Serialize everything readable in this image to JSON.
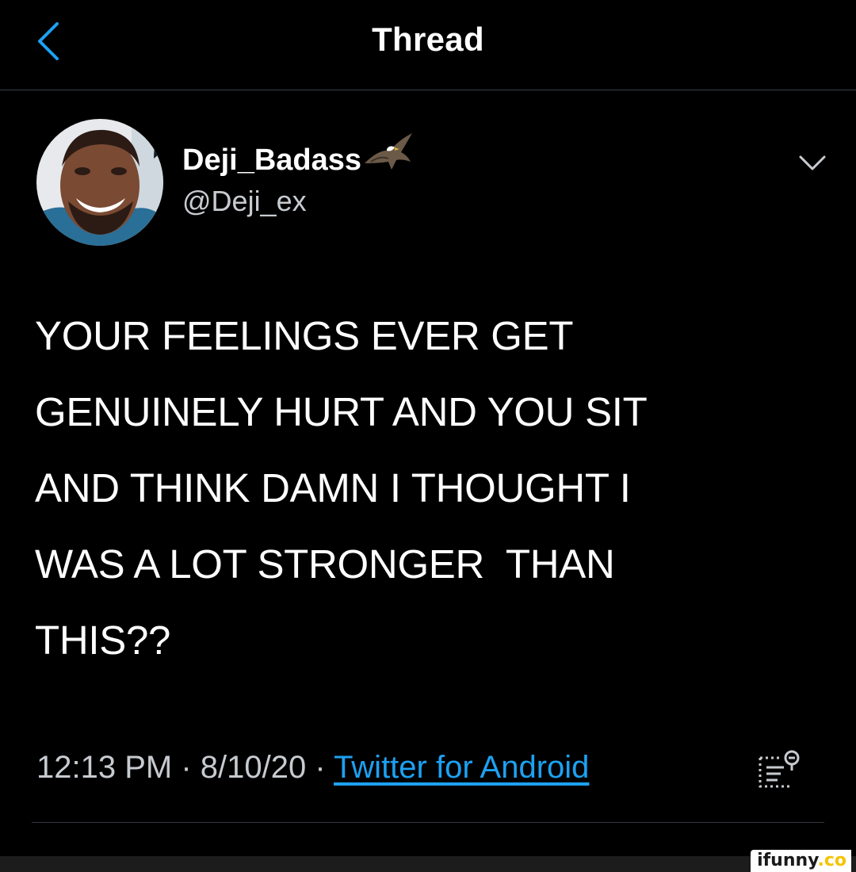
{
  "header": {
    "title": "Thread",
    "back_icon": "chevron-left-icon",
    "accent": "#1da1f2"
  },
  "tweet": {
    "author": {
      "display_name": "Deji_Badass",
      "handle": "@Deji_ex",
      "name_emoji": "eagle-icon"
    },
    "text_lines": [
      "YOUR FEELINGS EVER GET",
      "GENUINELY HURT AND YOU SIT",
      "AND THINK DAMN I THOUGHT I",
      "WAS A LOT STRONGER  THAN",
      "THIS??"
    ],
    "meta": {
      "time": "12:13 PM",
      "separator": " · ",
      "date": "8/10/20",
      "source": "Twitter for Android"
    },
    "menu_icon": "chevron-down-icon",
    "analytics_icon": "analytics-icon"
  },
  "watermark": {
    "text": "ifunny",
    "suffix": ".co"
  }
}
